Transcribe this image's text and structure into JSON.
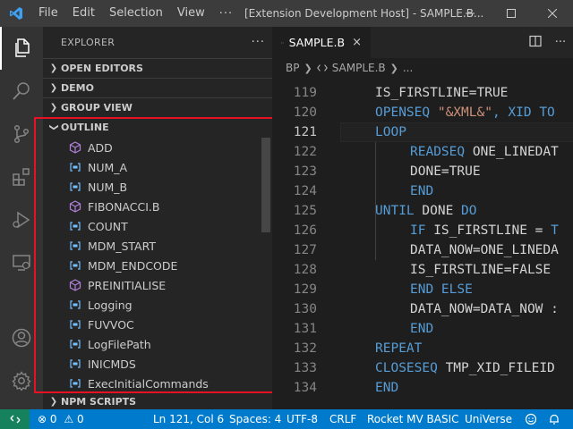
{
  "titlebar": {
    "menu": [
      "File",
      "Edit",
      "Selection",
      "View"
    ],
    "more": "···",
    "title": "[Extension Development Host] - SAMPLE.B..."
  },
  "sidebar": {
    "title": "EXPLORER",
    "more": "···",
    "sections": [
      {
        "label": "OPEN EDITORS",
        "expanded": false
      },
      {
        "label": "DEMO",
        "expanded": false
      },
      {
        "label": "GROUP VIEW",
        "expanded": false
      },
      {
        "label": "OUTLINE",
        "expanded": true
      }
    ],
    "outline": [
      {
        "name": "ADD",
        "icon": "method-icon"
      },
      {
        "name": "NUM_A",
        "icon": "variable-icon"
      },
      {
        "name": "NUM_B",
        "icon": "variable-icon"
      },
      {
        "name": "FIBONACCI.B",
        "icon": "method-icon"
      },
      {
        "name": "COUNT",
        "icon": "variable-icon"
      },
      {
        "name": "MDM_START",
        "icon": "variable-icon"
      },
      {
        "name": "MDM_ENDCODE",
        "icon": "variable-icon"
      },
      {
        "name": "PREINITIALISE",
        "icon": "method-icon"
      },
      {
        "name": "Logging",
        "icon": "variable-icon"
      },
      {
        "name": "FUVVOC",
        "icon": "variable-icon"
      },
      {
        "name": "LogFilePath",
        "icon": "variable-icon"
      },
      {
        "name": "INICMDS",
        "icon": "variable-icon"
      },
      {
        "name": "ExecInitialCommands",
        "icon": "variable-icon"
      }
    ],
    "npm_scripts": "NPM SCRIPTS"
  },
  "editor": {
    "tab": {
      "name": "SAMPLE.B",
      "close": "×"
    },
    "breadcrumb": [
      "BP",
      "SAMPLE.B",
      "..."
    ],
    "current_line": 121,
    "lines": [
      {
        "n": 119,
        "indent": 0,
        "parts": [
          {
            "t": "IS_FIRSTLINE=TRUE",
            "c": "id"
          }
        ]
      },
      {
        "n": 120,
        "indent": 0,
        "parts": [
          {
            "t": "OPENSEQ ",
            "c": "kw"
          },
          {
            "t": "\"&XML&\"",
            "c": "st"
          },
          {
            "t": ", XID TO",
            "c": "kw"
          }
        ]
      },
      {
        "n": 121,
        "indent": 0,
        "parts": [
          {
            "t": "LOOP",
            "c": "kw"
          }
        ]
      },
      {
        "n": 122,
        "indent": 1,
        "parts": [
          {
            "t": "READSEQ",
            "c": "kw"
          },
          {
            "t": " ONE_LINEDAT",
            "c": "id"
          }
        ]
      },
      {
        "n": 123,
        "indent": 1,
        "parts": [
          {
            "t": "DONE=TRUE",
            "c": "id"
          }
        ]
      },
      {
        "n": 124,
        "indent": 1,
        "parts": [
          {
            "t": "END",
            "c": "kw"
          }
        ]
      },
      {
        "n": 125,
        "indent": 0,
        "parts": [
          {
            "t": "UNTIL",
            "c": "kw"
          },
          {
            "t": " DONE ",
            "c": "id"
          },
          {
            "t": "DO",
            "c": "kw"
          }
        ]
      },
      {
        "n": 126,
        "indent": 1,
        "parts": [
          {
            "t": "IF",
            "c": "kw"
          },
          {
            "t": " IS_FIRSTLINE = ",
            "c": "id"
          },
          {
            "t": "T",
            "c": "kw"
          }
        ]
      },
      {
        "n": 127,
        "indent": 1,
        "parts": [
          {
            "t": "DATA_NOW=ONE_LINEDA",
            "c": "id"
          }
        ]
      },
      {
        "n": 128,
        "indent": 1,
        "parts": [
          {
            "t": "IS_FIRSTLINE=FALSE",
            "c": "id"
          }
        ]
      },
      {
        "n": 129,
        "indent": 1,
        "parts": [
          {
            "t": "END ELSE",
            "c": "kw"
          }
        ]
      },
      {
        "n": 130,
        "indent": 1,
        "parts": [
          {
            "t": "DATA_NOW=DATA_NOW ",
            "c": "id"
          },
          {
            "t": ":",
            "c": "id"
          }
        ]
      },
      {
        "n": 131,
        "indent": 1,
        "parts": [
          {
            "t": "END",
            "c": "kw"
          }
        ]
      },
      {
        "n": 132,
        "indent": 0,
        "parts": [
          {
            "t": "REPEAT",
            "c": "kw"
          }
        ]
      },
      {
        "n": 133,
        "indent": 0,
        "parts": [
          {
            "t": "CLOSESEQ",
            "c": "kw"
          },
          {
            "t": " TMP_XID_FILEID",
            "c": "id"
          }
        ]
      },
      {
        "n": 134,
        "indent": 0,
        "parts": [
          {
            "t": "END",
            "c": "kw"
          }
        ]
      }
    ]
  },
  "statusbar": {
    "errors": "0",
    "warnings": "0",
    "position": "Ln 121, Col 6",
    "spaces": "Spaces: 4",
    "encoding": "UTF-8",
    "eol": "CRLF",
    "language": "Rocket MV BASIC",
    "universe": "UniVerse"
  },
  "colors": {
    "statusbar": "#007acc",
    "remote": "#16825d",
    "keyword": "#569cd6",
    "string": "#ce9178",
    "highlight_box": "#e81123",
    "method_icon": "#b180d7",
    "variable_icon": "#75beff"
  }
}
